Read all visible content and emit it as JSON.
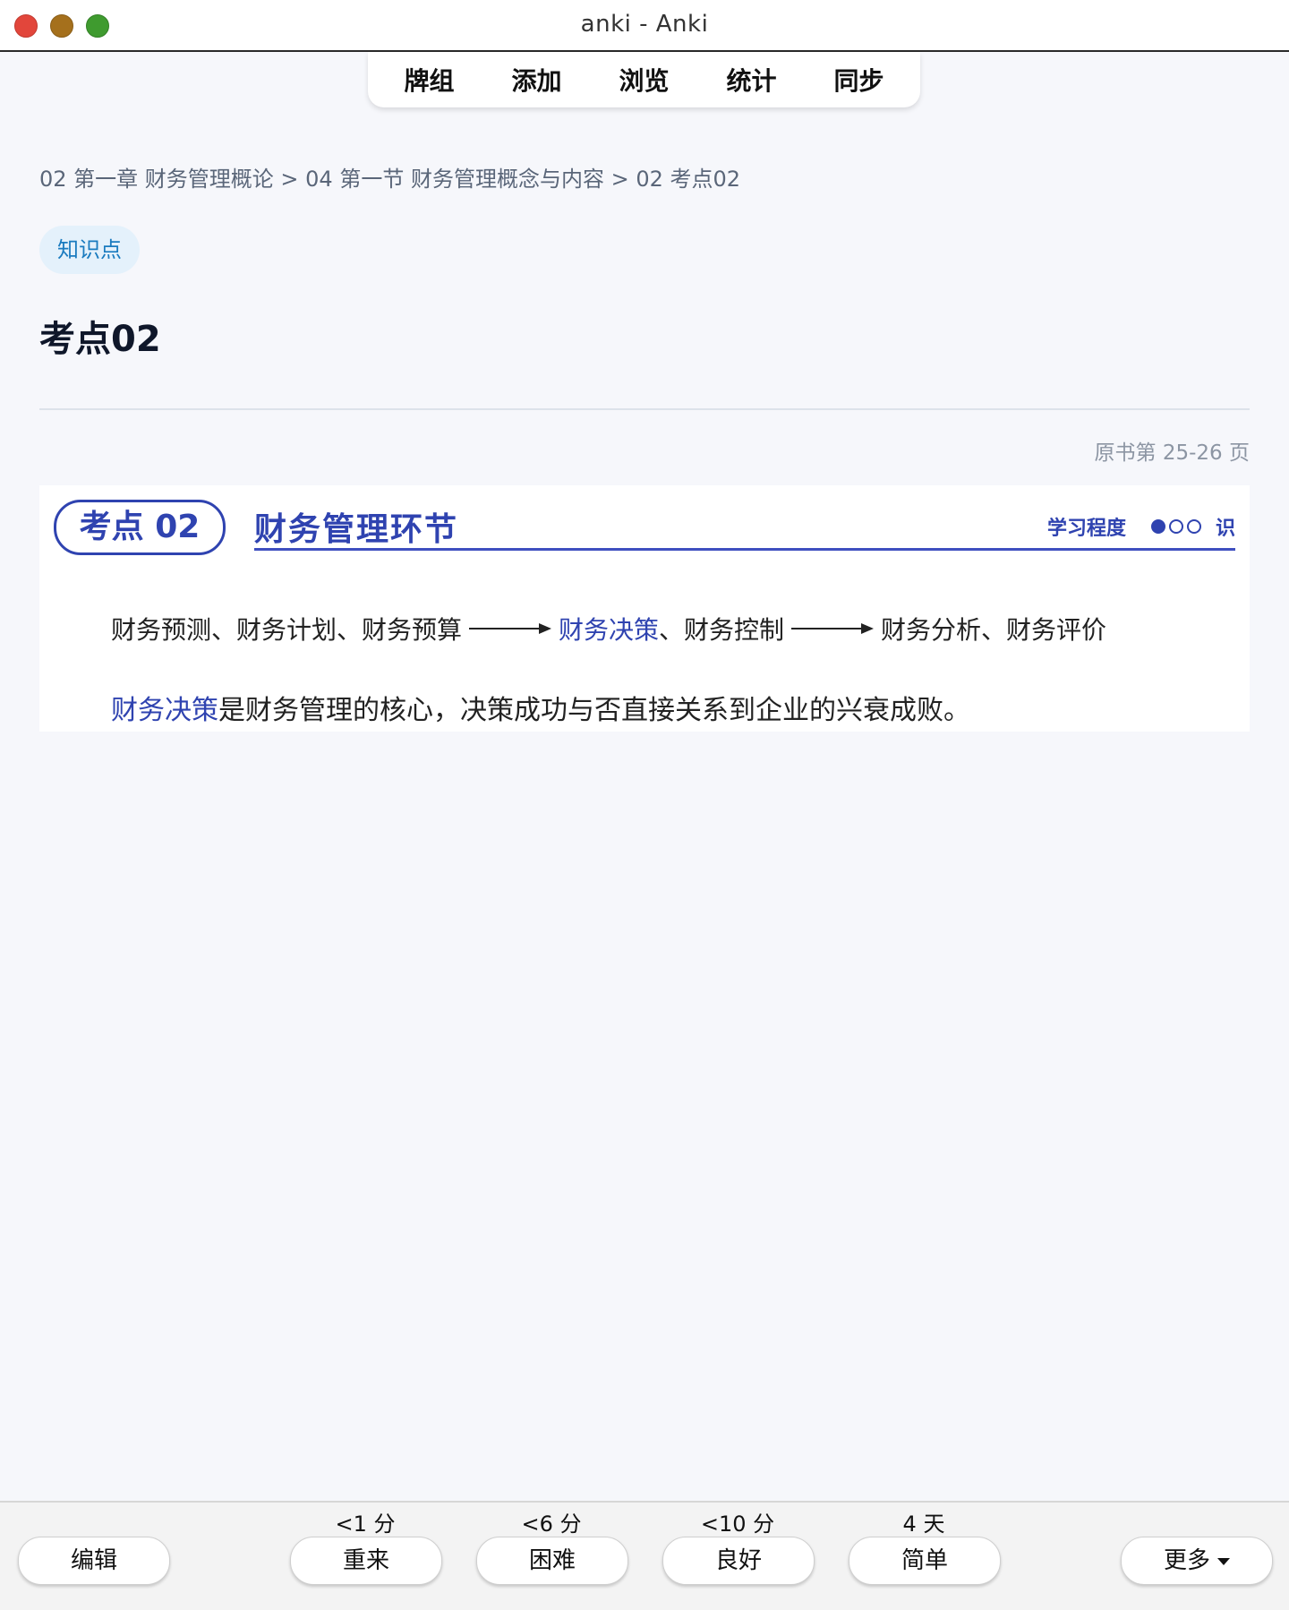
{
  "window": {
    "title": "anki - Anki"
  },
  "nav": {
    "items": [
      "牌组",
      "添加",
      "浏览",
      "统计",
      "同步"
    ]
  },
  "card": {
    "breadcrumb": "02 第一章 财务管理概论 > 04 第一节 财务管理概念与内容 > 02 考点02",
    "tag": "知识点",
    "heading": "考点02",
    "page_ref": "原书第 25-26 页"
  },
  "figure": {
    "pill": "考点 02",
    "title": "财务管理环节",
    "study_level_label": "学习程度",
    "study_level_filled": 1,
    "study_level_total": 3,
    "study_level_suffix": "识",
    "flow": {
      "part1": "财务预测、财务计划、财务预算",
      "part2_hl": "财务决策",
      "part2_rest": "、财务控制",
      "part3": "财务分析、财务评价"
    },
    "sentence": {
      "hl": "财务决策",
      "rest": "是财务管理的核心，决策成功与否直接关系到企业的兴衰成败。"
    },
    "colors": {
      "accent": "#2f43b0"
    }
  },
  "review": {
    "edit_label": "编辑",
    "more_label": "更多",
    "buttons": [
      {
        "interval": "<1 分",
        "label": "重来"
      },
      {
        "interval": "<6 分",
        "label": "困难"
      },
      {
        "interval": "<10 分",
        "label": "良好"
      },
      {
        "interval": "4 天",
        "label": "简单"
      }
    ]
  }
}
